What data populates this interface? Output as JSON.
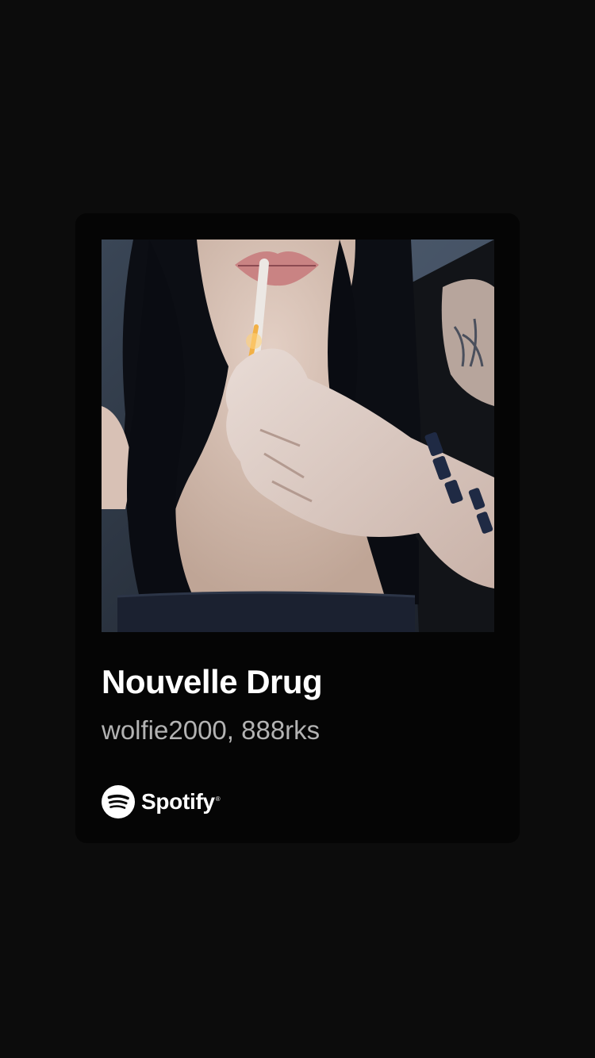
{
  "share_card": {
    "cover_art": {
      "icon": "album-cover-image"
    },
    "track": {
      "title": "Nouvelle Drug",
      "artists": "wolfie2000, 888rks"
    },
    "brand": {
      "icon": "spotify-logo-icon",
      "name": "Spotify",
      "trademark": "®"
    }
  },
  "colors": {
    "background": "#0c0c0c",
    "card": "#050505",
    "title": "#ffffff",
    "subtitle": "#b3b3b3"
  }
}
